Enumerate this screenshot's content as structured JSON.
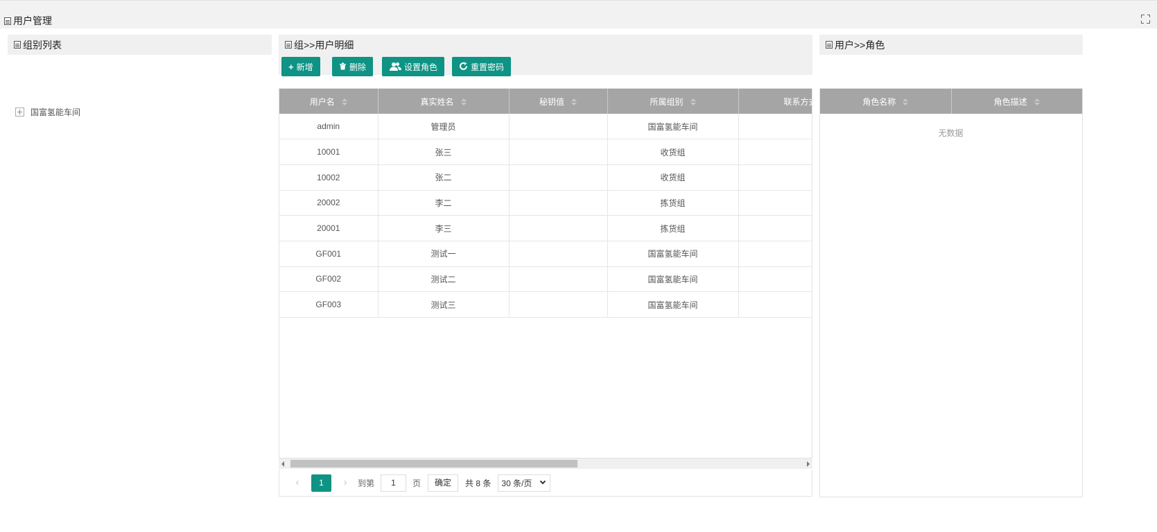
{
  "page": {
    "title": "用户管理",
    "fullscreen_icon": "fullscreen-icon"
  },
  "groups_panel": {
    "title": "组别列表",
    "tree": [
      {
        "label": "国富氢能车间",
        "expanded": false
      }
    ]
  },
  "users_panel": {
    "title": "组>>用户明细",
    "toolbar": {
      "add_label": "新增",
      "delete_label": "删除",
      "set_role_label": "设置角色",
      "reset_password_label": "重置密码"
    },
    "columns": [
      "用户名",
      "真实姓名",
      "秘钥值",
      "所属组别",
      "联系方式"
    ],
    "rows": [
      {
        "username": "admin",
        "realname": "管理员",
        "secret": "",
        "group": "国富氢能车间",
        "contact": ""
      },
      {
        "username": "10001",
        "realname": "张三",
        "secret": "",
        "group": "收货组",
        "contact": ""
      },
      {
        "username": "10002",
        "realname": "张二",
        "secret": "",
        "group": "收货组",
        "contact": ""
      },
      {
        "username": "20002",
        "realname": "李二",
        "secret": "",
        "group": "拣货组",
        "contact": ""
      },
      {
        "username": "20001",
        "realname": "李三",
        "secret": "",
        "group": "拣货组",
        "contact": ""
      },
      {
        "username": "GF001",
        "realname": "测试一",
        "secret": "",
        "group": "国富氢能车间",
        "contact": ""
      },
      {
        "username": "GF002",
        "realname": "测试二",
        "secret": "",
        "group": "国富氢能车间",
        "contact": ""
      },
      {
        "username": "GF003",
        "realname": "测试三",
        "secret": "",
        "group": "国富氢能车间",
        "contact": ""
      }
    ],
    "pager": {
      "current_page": "1",
      "goto_label": "到第",
      "goto_value": "1",
      "page_unit": "页",
      "confirm_label": "确定",
      "total_text": "共 8 条",
      "page_size": "30 条/页"
    }
  },
  "roles_panel": {
    "title": "用户>>角色",
    "columns": [
      "角色名称",
      "角色描述"
    ],
    "empty_text": "无数据"
  },
  "colors": {
    "accent": "#0e9384",
    "header_bg": "#a5a5a5",
    "panel_bg": "#f0f0f0"
  }
}
